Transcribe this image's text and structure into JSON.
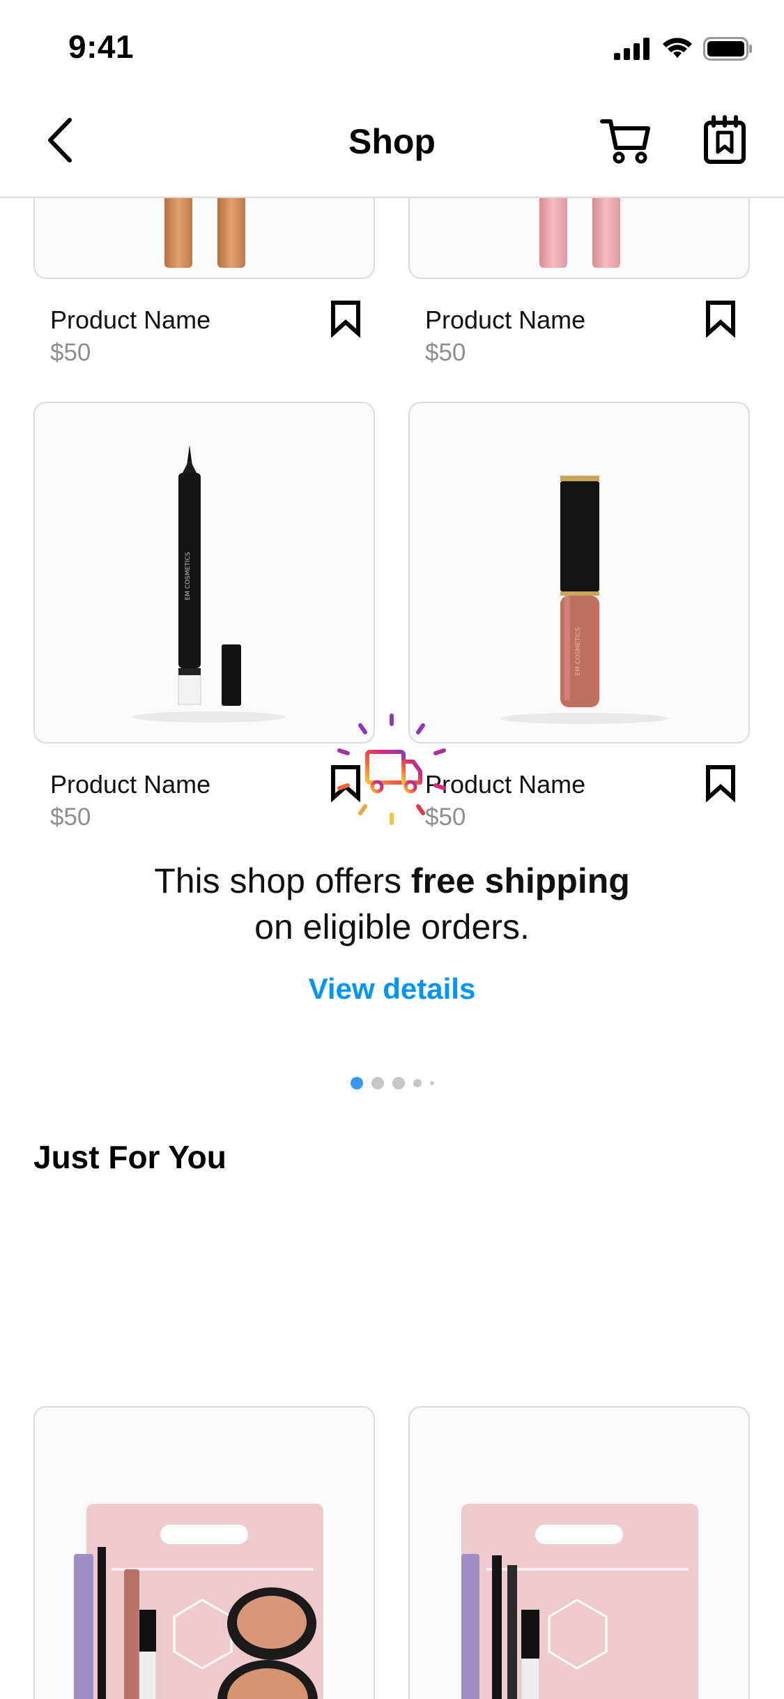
{
  "status": {
    "time": "9:41"
  },
  "nav": {
    "title": "Shop",
    "icons": [
      "back-chevron-icon",
      "cart-icon",
      "saved-collection-icon"
    ]
  },
  "products": [
    {
      "name": "Product Name",
      "price": "$50",
      "image": "lipstick-orange"
    },
    {
      "name": "Product Name",
      "price": "$50",
      "image": "lipstick-pink"
    },
    {
      "name": "Product Name",
      "price": "$50",
      "image": "eyeliner-pen"
    },
    {
      "name": "Product Name",
      "price": "$50",
      "image": "lip-gloss"
    }
  ],
  "promo": {
    "text_before": "This shop offers ",
    "text_bold": "free shipping",
    "text_after": "on eligible orders.",
    "link": "View details",
    "icon": "delivery-truck-icon"
  },
  "pagination": {
    "active_index": 0,
    "count": 5
  },
  "just_for_you": {
    "title": "Just For You",
    "items": [
      {
        "image": "makeup-kit-bag-with-compact"
      },
      {
        "image": "makeup-kit-bag"
      }
    ]
  },
  "colors": {
    "link": "#0095f6",
    "price": "#8e8e8e",
    "dot_active": "#3897f0",
    "border": "#dbdbdb"
  }
}
